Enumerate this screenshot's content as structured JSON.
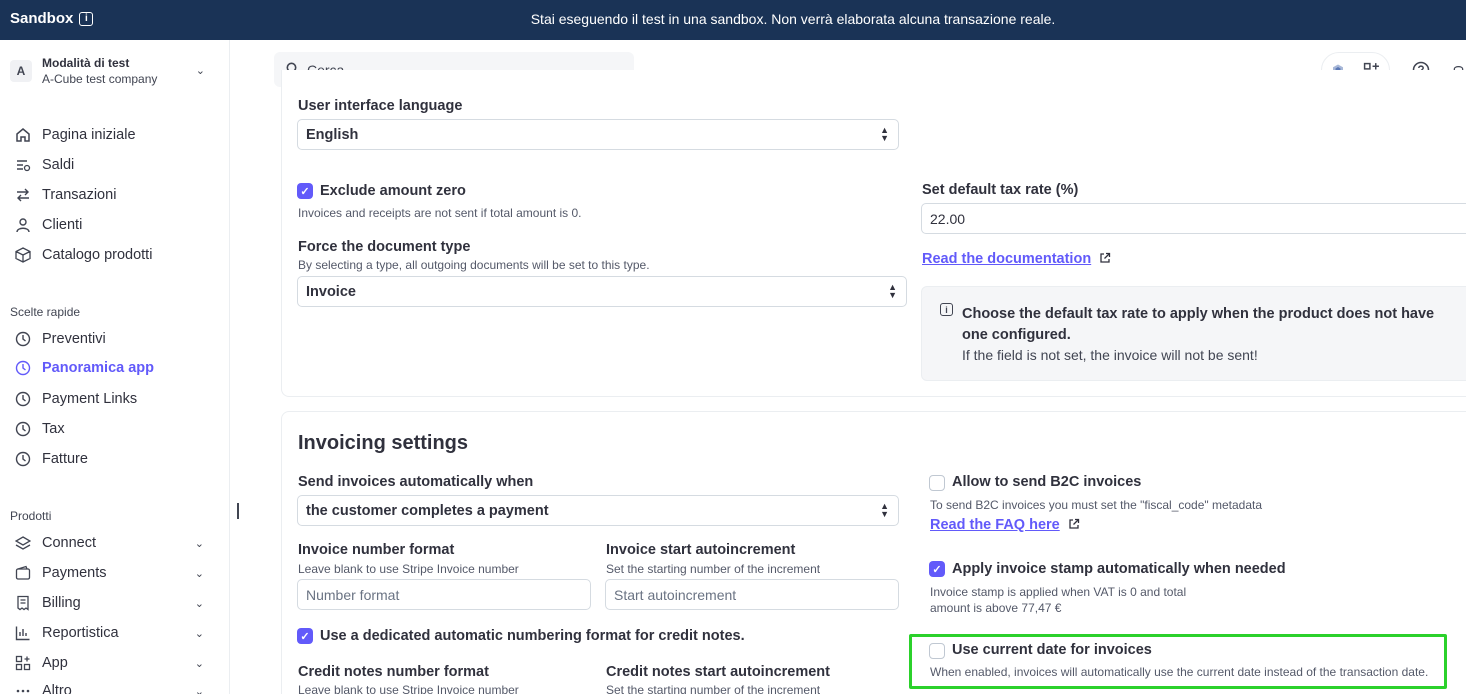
{
  "banner": {
    "brand": "Sandbox",
    "message": "Stai eseguendo il test in una sandbox. Non verrà elaborata alcuna transazione reale."
  },
  "account": {
    "initial": "A",
    "mode": "Modalità di test",
    "company": "A-Cube test company"
  },
  "nav": {
    "main": [
      {
        "label": "Pagina iniziale",
        "icon": "home-icon"
      },
      {
        "label": "Saldi",
        "icon": "balances-icon"
      },
      {
        "label": "Transazioni",
        "icon": "arrows-icon"
      },
      {
        "label": "Clienti",
        "icon": "person-icon"
      },
      {
        "label": "Catalogo prodotti",
        "icon": "box-icon"
      }
    ],
    "shortcuts_title": "Scelte rapide",
    "shortcuts": [
      {
        "label": "Preventivi",
        "icon": "clock-icon"
      },
      {
        "label": "Panoramica app",
        "icon": "clock-icon",
        "active": true
      },
      {
        "label": "Payment Links",
        "icon": "clock-icon"
      },
      {
        "label": "Tax",
        "icon": "clock-icon"
      },
      {
        "label": "Fatture",
        "icon": "clock-icon"
      }
    ],
    "products_title": "Prodotti",
    "products": [
      {
        "label": "Connect",
        "icon": "layers-icon"
      },
      {
        "label": "Payments",
        "icon": "wallet-icon"
      },
      {
        "label": "Billing",
        "icon": "receipt-icon"
      },
      {
        "label": "Reportistica",
        "icon": "bar-chart-icon"
      },
      {
        "label": "App",
        "icon": "apps-icon"
      },
      {
        "label": "Altro",
        "icon": "more-icon"
      }
    ]
  },
  "search": {
    "placeholder": "Cerca"
  },
  "settings": {
    "ui_language_label": "User interface language",
    "ui_language_value": "English",
    "exclude_zero_label": "Exclude amount zero",
    "exclude_zero_hint": "Invoices and receipts are not sent if total amount is 0.",
    "force_doc_label": "Force the document type",
    "force_doc_hint": "By selecting a type, all outgoing documents will be set to this type.",
    "force_doc_value": "Invoice",
    "tax_rate_label": "Set default tax rate (%)",
    "tax_rate_value": "22.00",
    "read_docs": "Read the documentation",
    "callout_title": "Choose the default tax rate to apply when the product does not have one configured.",
    "callout_body": "If the field is not set, the invoice will not be sent!"
  },
  "invoicing": {
    "title": "Invoicing settings",
    "send_when_label": "Send invoices automatically when",
    "send_when_value": "the customer completes a payment",
    "number_format_label": "Invoice number format",
    "number_format_hint": "Leave blank to use Stripe Invoice number",
    "number_format_placeholder": "Number format",
    "start_auto_label": "Invoice start autoincrement",
    "start_auto_hint": "Set the starting number of the increment",
    "start_auto_placeholder": "Start autoincrement",
    "credit_notes_cb_label": "Use a dedicated automatic numbering format for credit notes.",
    "credit_format_label": "Credit notes number format",
    "credit_format_hint": "Leave blank to use Stripe Invoice number",
    "credit_start_label": "Credit notes start autoincrement",
    "credit_start_hint": "Set the starting number of the increment",
    "b2c_label": "Allow to send B2C invoices",
    "b2c_hint": "To send B2C invoices you must set the \"fiscal_code\" metadata",
    "read_faq": "Read the FAQ here",
    "stamp_label": "Apply invoice stamp automatically when needed",
    "stamp_hint_1": "Invoice stamp is applied when VAT is 0 and total",
    "stamp_hint_2": "amount is above 77,47 €",
    "current_date_label": "Use current date for invoices",
    "current_date_hint": "When enabled, invoices will automatically use the current date instead of the transaction date."
  }
}
